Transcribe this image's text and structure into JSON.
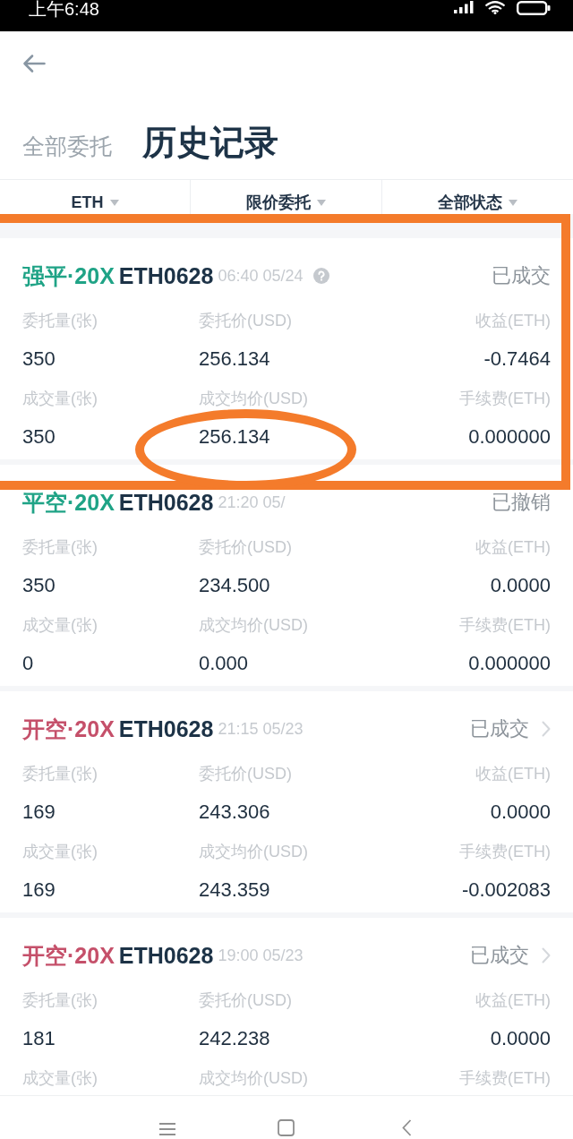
{
  "status_bar": {
    "time": "上午6:48"
  },
  "tabs": [
    {
      "label": "全部委托",
      "selected": false
    },
    {
      "label": "历史记录",
      "selected": true
    }
  ],
  "filters": [
    {
      "label": "ETH"
    },
    {
      "label": "限价委托"
    },
    {
      "label": "全部状态"
    }
  ],
  "cards": [
    {
      "type": "强平·20X",
      "color": "#1fa386",
      "contract": "ETH0628",
      "time": "06:40 05/24",
      "help": true,
      "status": "已成交",
      "chevron": false,
      "boxed": true,
      "cells": [
        {
          "label": "委托量(张)",
          "value": "350",
          "circled": false
        },
        {
          "label": "委托价(USD)",
          "value": "256.134",
          "circled": false
        },
        {
          "label": "收益(ETH)",
          "value": "-0.7464",
          "circled": false
        },
        {
          "label": "成交量(张)",
          "value": "350",
          "circled": false
        },
        {
          "label": "成交均价(USD)",
          "value": "256.134",
          "circled": true
        },
        {
          "label": "手续费(ETH)",
          "value": "0.000000",
          "circled": false
        }
      ]
    },
    {
      "type": "平空·20X",
      "color": "#1fa386",
      "contract": "ETH0628",
      "time": "21:20 05/",
      "help": false,
      "status": "已撤销",
      "chevron": false,
      "boxed": false,
      "cells": [
        {
          "label": "委托量(张)",
          "value": "350",
          "circled": false
        },
        {
          "label": "委托价(USD)",
          "value": "234.500",
          "circled": false
        },
        {
          "label": "收益(ETH)",
          "value": "0.0000",
          "circled": false
        },
        {
          "label": "成交量(张)",
          "value": "0",
          "circled": false
        },
        {
          "label": "成交均价(USD)",
          "value": "0.000",
          "circled": false
        },
        {
          "label": "手续费(ETH)",
          "value": "0.000000",
          "circled": false
        }
      ]
    },
    {
      "type": "开空·20X",
      "color": "#c5506a",
      "contract": "ETH0628",
      "time": "21:15 05/23",
      "help": false,
      "status": "已成交",
      "chevron": true,
      "boxed": false,
      "cells": [
        {
          "label": "委托量(张)",
          "value": "169",
          "circled": false
        },
        {
          "label": "委托价(USD)",
          "value": "243.306",
          "circled": false
        },
        {
          "label": "收益(ETH)",
          "value": "0.0000",
          "circled": false
        },
        {
          "label": "成交量(张)",
          "value": "169",
          "circled": false
        },
        {
          "label": "成交均价(USD)",
          "value": "243.359",
          "circled": false
        },
        {
          "label": "手续费(ETH)",
          "value": "-0.002083",
          "circled": false
        }
      ]
    },
    {
      "type": "开空·20X",
      "color": "#c5506a",
      "contract": "ETH0628",
      "time": "19:00 05/23",
      "help": false,
      "status": "已成交",
      "chevron": true,
      "boxed": false,
      "cells": [
        {
          "label": "委托量(张)",
          "value": "181",
          "circled": false
        },
        {
          "label": "委托价(USD)",
          "value": "242.238",
          "circled": false
        },
        {
          "label": "收益(ETH)",
          "value": "0.0000",
          "circled": false
        },
        {
          "label": "成交量(张)",
          "circled": false
        },
        {
          "label": "成交均价(USD)",
          "circled": false
        },
        {
          "label": "手续费(ETH)",
          "circled": false
        }
      ]
    }
  ]
}
